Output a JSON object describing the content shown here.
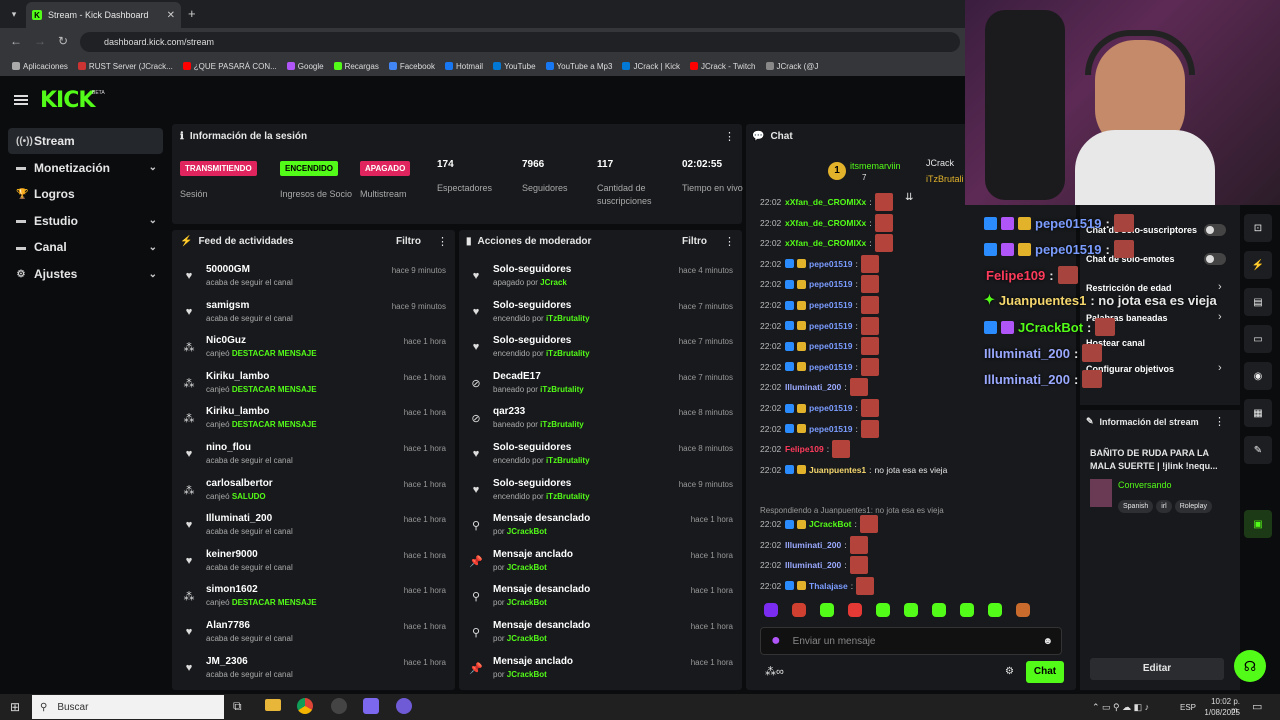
{
  "browser": {
    "tab_title": "Stream - Kick Dashboard",
    "url": "dashboard.kick.com/stream",
    "bookmarks": [
      "Aplicaciones",
      "RUST Server (JCrack...",
      "¿QUE PASARÁ CON...",
      "Google",
      "Recargas",
      "Facebook",
      "Hotmail",
      "YouTube",
      "YouTube a Mp3",
      "JCrack | Kick",
      "JCrack - Twitch",
      "JCrack (@J"
    ]
  },
  "logo": "KICK",
  "beta": "BETA",
  "sidebar": [
    {
      "label": "Stream",
      "icon": "broadcast-icon",
      "active": true
    },
    {
      "label": "Monetización",
      "icon": "wallet-icon",
      "chevron": true
    },
    {
      "label": "Logros",
      "icon": "trophy-icon"
    },
    {
      "label": "Estudio",
      "icon": "studio-icon",
      "chevron": true
    },
    {
      "label": "Canal",
      "icon": "channel-icon",
      "chevron": true
    },
    {
      "label": "Ajustes",
      "icon": "gear-icon",
      "chevron": true
    }
  ],
  "session": {
    "title": "Información de la sesión",
    "items": [
      {
        "badge": "TRANSMITIENDO",
        "label": "Sesión",
        "color": "#e0245e"
      },
      {
        "badge": "ENCENDIDO",
        "label": "Ingresos de Socio",
        "color": "#53fc18"
      },
      {
        "badge": "APAGADO",
        "label": "Multistream",
        "color": "#e0245e"
      },
      {
        "value": "174",
        "label": "Espectadores"
      },
      {
        "value": "7966",
        "label": "Seguidores"
      },
      {
        "value": "117",
        "label": "Cantidad de suscripciones"
      },
      {
        "value": "02:02:55",
        "label": "Tiempo en vivo"
      }
    ]
  },
  "feed": {
    "title": "Feed de actividades",
    "filter": "Filtro",
    "items": [
      {
        "name": "50000GM",
        "action": "acaba de seguir el canal",
        "time": "hace 9 minutos",
        "type": "heart"
      },
      {
        "name": "samigsm",
        "action": "acaba de seguir el canal",
        "time": "hace 9 minutos",
        "type": "heart"
      },
      {
        "name": "Nic0Guz",
        "action": "canjeó",
        "highlight": "DESTACAR MENSAJE",
        "time": "hace 1 hora",
        "type": "redeem"
      },
      {
        "name": "Kiriku_lambo",
        "action": "canjeó",
        "highlight": "DESTACAR MENSAJE",
        "time": "hace 1 hora",
        "type": "redeem"
      },
      {
        "name": "Kiriku_lambo",
        "action": "canjeó",
        "highlight": "DESTACAR MENSAJE",
        "time": "hace 1 hora",
        "type": "redeem"
      },
      {
        "name": "nino_flou",
        "action": "acaba de seguir el canal",
        "time": "hace 1 hora",
        "type": "heart"
      },
      {
        "name": "carlosalbertor",
        "action": "canjeó",
        "highlight": "SALUDO",
        "time": "hace 1 hora",
        "type": "redeem"
      },
      {
        "name": "Illuminati_200",
        "action": "acaba de seguir el canal",
        "time": "hace 1 hora",
        "type": "heart"
      },
      {
        "name": "keiner9000",
        "action": "acaba de seguir el canal",
        "time": "hace 1 hora",
        "type": "heart"
      },
      {
        "name": "simon1602",
        "action": "canjeó",
        "highlight": "DESTACAR MENSAJE",
        "time": "hace 1 hora",
        "type": "redeem"
      },
      {
        "name": "Alan7786",
        "action": "acaba de seguir el canal",
        "time": "hace 1 hora",
        "type": "heart"
      },
      {
        "name": "JM_2306",
        "action": "acaba de seguir el canal",
        "time": "hace 1 hora",
        "type": "heart"
      }
    ]
  },
  "mod": {
    "title": "Acciones de moderador",
    "filter": "Filtro",
    "items": [
      {
        "name": "Solo-seguidores",
        "action": "apagado por",
        "by": "JCrack",
        "time": "hace 4 minutos",
        "type": "heart"
      },
      {
        "name": "Solo-seguidores",
        "action": "encendido por",
        "by": "iTzBrutality",
        "time": "hace 7 minutos",
        "type": "heart"
      },
      {
        "name": "Solo-seguidores",
        "action": "encendido por",
        "by": "iTzBrutality",
        "time": "hace 7 minutos",
        "type": "heart"
      },
      {
        "name": "DecadE17",
        "action": "baneado por",
        "by": "iTzBrutality",
        "time": "hace 7 minutos",
        "type": "ban"
      },
      {
        "name": "qar233",
        "action": "baneado por",
        "by": "iTzBrutality",
        "time": "hace 8 minutos",
        "type": "ban"
      },
      {
        "name": "Solo-seguidores",
        "action": "encendido por",
        "by": "iTzBrutality",
        "time": "hace 8 minutos",
        "type": "heart"
      },
      {
        "name": "Solo-seguidores",
        "action": "encendido por",
        "by": "iTzBrutality",
        "time": "hace 9 minutos",
        "type": "heart"
      },
      {
        "name": "Mensaje desanclado",
        "action": "por",
        "by": "JCrackBot",
        "time": "hace 1 hora",
        "type": "unpin"
      },
      {
        "name": "Mensaje anclado",
        "action": "por",
        "by": "JCrackBot",
        "time": "hace 1 hora",
        "type": "pin"
      },
      {
        "name": "Mensaje desanclado",
        "action": "por",
        "by": "JCrackBot",
        "time": "hace 1 hora",
        "type": "unpin"
      },
      {
        "name": "Mensaje desanclado",
        "action": "por",
        "by": "JCrackBot",
        "time": "hace 1 hora",
        "type": "unpin"
      },
      {
        "name": "Mensaje anclado",
        "action": "por",
        "by": "JCrackBot",
        "time": "hace 1 hora",
        "type": "pin"
      }
    ]
  },
  "chat": {
    "title": "Chat",
    "top": [
      {
        "rank": "1",
        "name": "itsmemarviin",
        "count": "7"
      },
      {
        "name": "JCrack"
      },
      {
        "name": "iTzBrutali"
      }
    ],
    "messages": [
      {
        "time": "22:02",
        "user": "xXfan_de_CROMIXx",
        "color": "#53fc18"
      },
      {
        "time": "22:02",
        "user": "xXfan_de_CROMIXx",
        "color": "#53fc18"
      },
      {
        "time": "22:02",
        "user": "xXfan_de_CROMIXx",
        "color": "#53fc18"
      },
      {
        "time": "22:02",
        "user": "pepe01519",
        "color": "#7b9cff"
      },
      {
        "time": "22:02",
        "user": "pepe01519",
        "color": "#7b9cff"
      },
      {
        "time": "22:02",
        "user": "pepe01519",
        "color": "#7b9cff"
      },
      {
        "time": "22:02",
        "user": "pepe01519",
        "color": "#7b9cff"
      },
      {
        "time": "22:02",
        "user": "pepe01519",
        "color": "#7b9cff"
      },
      {
        "time": "22:02",
        "user": "pepe01519",
        "color": "#7b9cff"
      },
      {
        "time": "22:02",
        "user": "Illuminati_200",
        "color": "#9aa9ff"
      },
      {
        "time": "22:02",
        "user": "pepe01519",
        "color": "#7b9cff"
      },
      {
        "time": "22:02",
        "user": "pepe01519",
        "color": "#7b9cff"
      },
      {
        "time": "22:02",
        "user": "Felipe109",
        "color": "#ff3b5c"
      },
      {
        "time": "22:02",
        "user": "Juanpuentes1",
        "color": "#f5d76e",
        "text": "no jota esa es vieja"
      }
    ],
    "reply": "Respondiendo a Juanpuentes1: no jota esa es vieja",
    "messages2": [
      {
        "time": "22:02",
        "user": "JCrackBot",
        "color": "#53fc18"
      },
      {
        "time": "22:02",
        "user": "Illuminati_200",
        "color": "#9aa9ff"
      },
      {
        "time": "22:02",
        "user": "Illuminati_200",
        "color": "#9aa9ff"
      },
      {
        "time": "22:02",
        "user": "Thalajase",
        "color": "#7b9cff"
      }
    ],
    "placeholder": "Enviar un mensaje",
    "send": "Chat"
  },
  "overlay": [
    {
      "user": "pepe01519",
      "color": "#7b9cff"
    },
    {
      "user": "pepe01519",
      "color": "#7b9cff"
    },
    {
      "user": "Felipe109",
      "color": "#ff3b5c"
    },
    {
      "user": "Juanpuentes1",
      "color": "#f5d76e",
      "text": ": no jota esa es vieja"
    },
    {
      "user": "JCrackBot",
      "color": "#53fc18"
    },
    {
      "user": "Illuminati_200",
      "color": "#9aa9ff"
    },
    {
      "user": "Illuminati_200",
      "color": "#9aa9ff"
    }
  ],
  "chat_settings": [
    "Chat de solo-suscriptores",
    "Chat de solo-emotes",
    "Restricción de edad",
    "Palabras baneadas",
    "Hostear canal",
    "Configurar objetivos"
  ],
  "stream_info": {
    "title": "Información del stream",
    "stream_title": "BAÑITO DE RUDA PARA LA MALA SUERTE | !jlink !nequ...",
    "category": "Conversando",
    "tags": [
      "Spanish",
      "irl",
      "Roleplay"
    ],
    "edit": "Editar"
  },
  "taskbar": {
    "search": "Buscar",
    "lang": "ESP",
    "time": "10:02 p. m.",
    "date": "1/08/2025"
  }
}
